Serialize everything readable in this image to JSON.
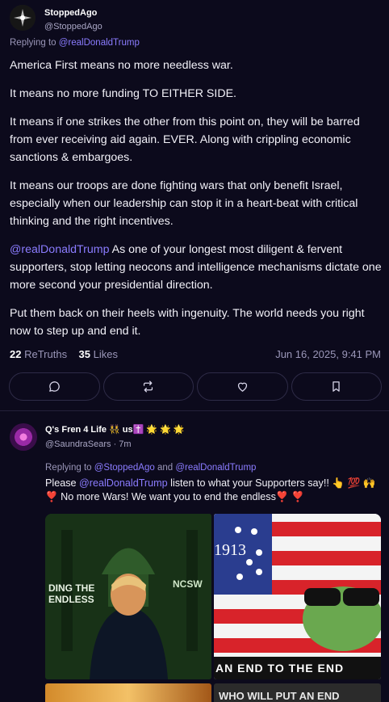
{
  "post": {
    "author_name": "StoppedAgo",
    "author_handle": "@StoppedAgo",
    "replying_prefix": "Replying to",
    "replying_to": "@realDonaldTrump",
    "paragraphs": [
      "America First means no more needless war.",
      "It means no more funding TO EITHER SIDE.",
      "It means if one strikes the other from this point on, they will be barred from ever receiving aid again. EVER. Along with crippling economic sanctions & embargoes.",
      "It means our troops are done fighting wars that only benefit Israel, especially when our leadership can stop it in a heart-beat with critical thinking and the right incentives."
    ],
    "mention_paragraph": {
      "mention": "@realDonaldTrump",
      "text": " As one of your longest most diligent & fervent supporters, stop letting neocons and intelligence mechanisms dictate one more second your presidential direction."
    },
    "final_paragraph": "Put them back on their heels with ingenuity. The world needs you right now to step up and end it.",
    "retruths_count": "22",
    "retruths_label": "ReTruths",
    "likes_count": "35",
    "likes_label": "Likes",
    "timestamp": "Jun 16, 2025, 9:41 PM",
    "actions": [
      "reply-icon",
      "retruth-icon",
      "like-icon",
      "bookmark-icon"
    ]
  },
  "reply": {
    "author_name": "Q's Fren 4 Life 👯 us✝️ 🌟 🌟 🌟",
    "author_handle": "@SaundraSears",
    "time_ago": "· 7m",
    "replying_prefix": "Replying to",
    "replying_to_1": "@StoppedAgo",
    "replying_and": "and",
    "replying_to_2": "@realDonaldTrump",
    "text_before": "Please ",
    "mention": "@realDonaldTrump",
    "text_after": " listen to what your Supporters say!! 👆 💯 🙌 ❣️ No more Wars! We want you to end the endless❣️ ❣️",
    "images": {
      "img1_text_left": "DING THE ENDLESS",
      "img1_text_right": "NCSW",
      "img2_flag_text": "1913",
      "img2_banner": "AN END TO THE END",
      "img4_banner": "WHO WILL PUT AN END"
    }
  },
  "colors": {
    "background": "#0c0a1c",
    "link": "#8b7cff",
    "muted": "#9a96b8",
    "border": "#2e2b47"
  }
}
